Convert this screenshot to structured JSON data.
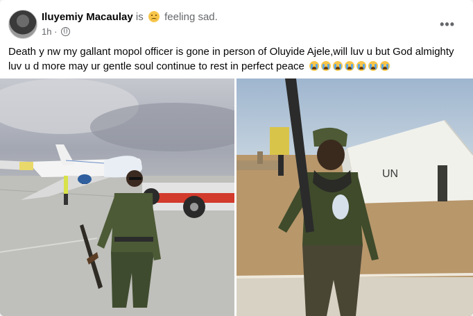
{
  "post": {
    "author_name": "Iluyemiy Macaulay",
    "is_text": "is",
    "feeling_text": "feeling sad.",
    "timestamp": "1h",
    "separator": "·",
    "body_text": "Death y nw my gallant mopol officer is gone in person of Oluyide Ajele,will luv u but God almighty luv u d more may ur gentle soul continue to rest in perfect peace",
    "crying_emoji_count": 7,
    "more_options_label": "•••"
  },
  "photos": {
    "right_tent_label": "UN"
  }
}
